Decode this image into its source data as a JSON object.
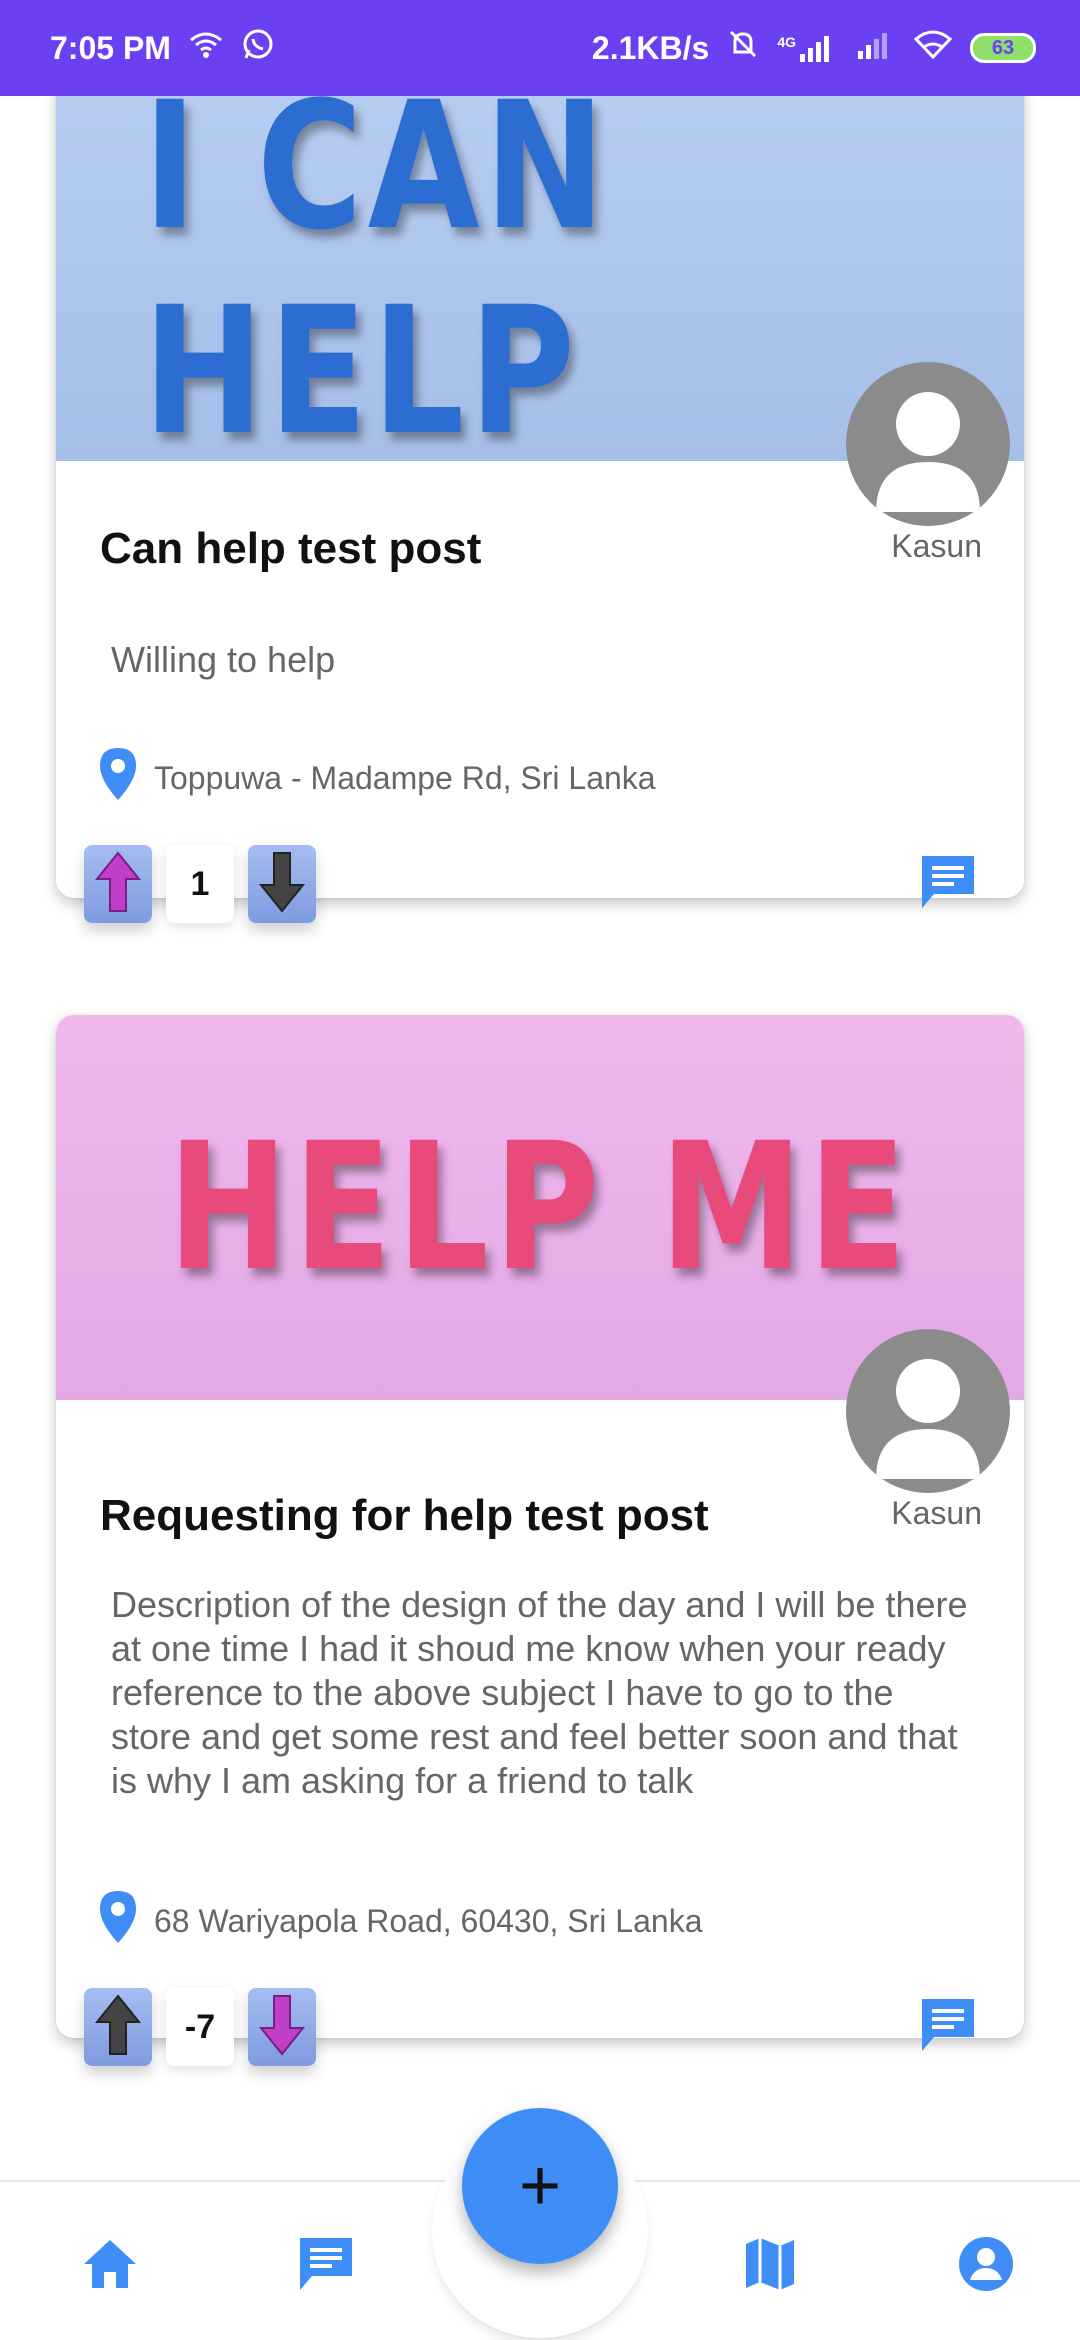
{
  "status_bar": {
    "time": "7:05 PM",
    "net_speed": "2.1KB/s",
    "network": "4G",
    "battery": "63",
    "icons": [
      "wifi-icon",
      "whatsapp-icon",
      "mute-icon",
      "signal-icon",
      "wifi-icon",
      "battery-icon"
    ]
  },
  "posts": [
    {
      "banner_text": "I CAN HELP",
      "title": "Can help test post",
      "author": "Kasun",
      "description": "Willing to help",
      "location": "Toppuwa - Madampe Rd, Sri Lanka",
      "votes": "1",
      "vote_state": "up"
    },
    {
      "banner_text": "HELP ME",
      "title": "Requesting for help test post",
      "author": "Kasun",
      "description": "Description of the design of the day and I will be there at one time I had it shoud me know when your ready reference to the above subject I have to go to the store and get some rest and feel better soon and that is why I am asking for a friend to talk",
      "location": "68 Wariyapola Road, 60430, Sri Lanka",
      "votes": "-7",
      "vote_state": "down"
    }
  ],
  "fab": {
    "label": "+"
  },
  "bottom_nav": {
    "items": [
      "home-icon",
      "chat-icon",
      "map-icon",
      "profile-icon"
    ]
  },
  "colors": {
    "status_bar": "#6b3ff2",
    "accent": "#3f8ef7",
    "active_arrow": "#c03fc9",
    "inactive_arrow": "#444444"
  }
}
